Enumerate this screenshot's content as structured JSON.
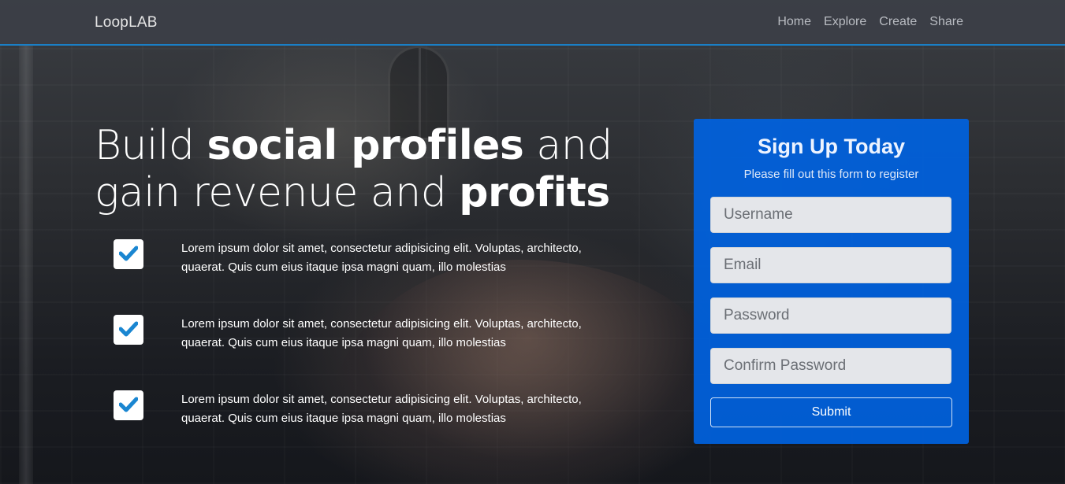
{
  "navbar": {
    "brand": "LoopLAB",
    "links": [
      "Home",
      "Explore",
      "Create",
      "Share"
    ]
  },
  "hero": {
    "headline_parts": [
      "Build ",
      "social profiles",
      " and gain revenue and ",
      "profits"
    ],
    "features": [
      {
        "icon": "check-icon",
        "text": "Lorem ipsum dolor sit amet, consectetur adipisicing elit. Voluptas, architecto, quaerat. Quis cum eius itaque ipsa magni quam, illo molestias"
      },
      {
        "icon": "check-icon",
        "text": "Lorem ipsum dolor sit amet, consectetur adipisicing elit. Voluptas, architecto, quaerat. Quis cum eius itaque ipsa magni quam, illo molestias"
      },
      {
        "icon": "check-icon",
        "text": "Lorem ipsum dolor sit amet, consectetur adipisicing elit. Voluptas, architecto, quaerat. Quis cum eius itaque ipsa magni quam, illo molestias"
      }
    ]
  },
  "signup": {
    "title": "Sign Up Today",
    "subtitle": "Please fill out this form to register",
    "fields": {
      "username": {
        "placeholder": "Username",
        "value": ""
      },
      "email": {
        "placeholder": "Email",
        "value": ""
      },
      "password": {
        "placeholder": "Password",
        "value": ""
      },
      "confirm_password": {
        "placeholder": "Confirm Password",
        "value": ""
      }
    },
    "submit_label": "Submit"
  },
  "colors": {
    "accent": "#1a7fc6",
    "card": "#0062e0",
    "check": "#1a86d1"
  }
}
